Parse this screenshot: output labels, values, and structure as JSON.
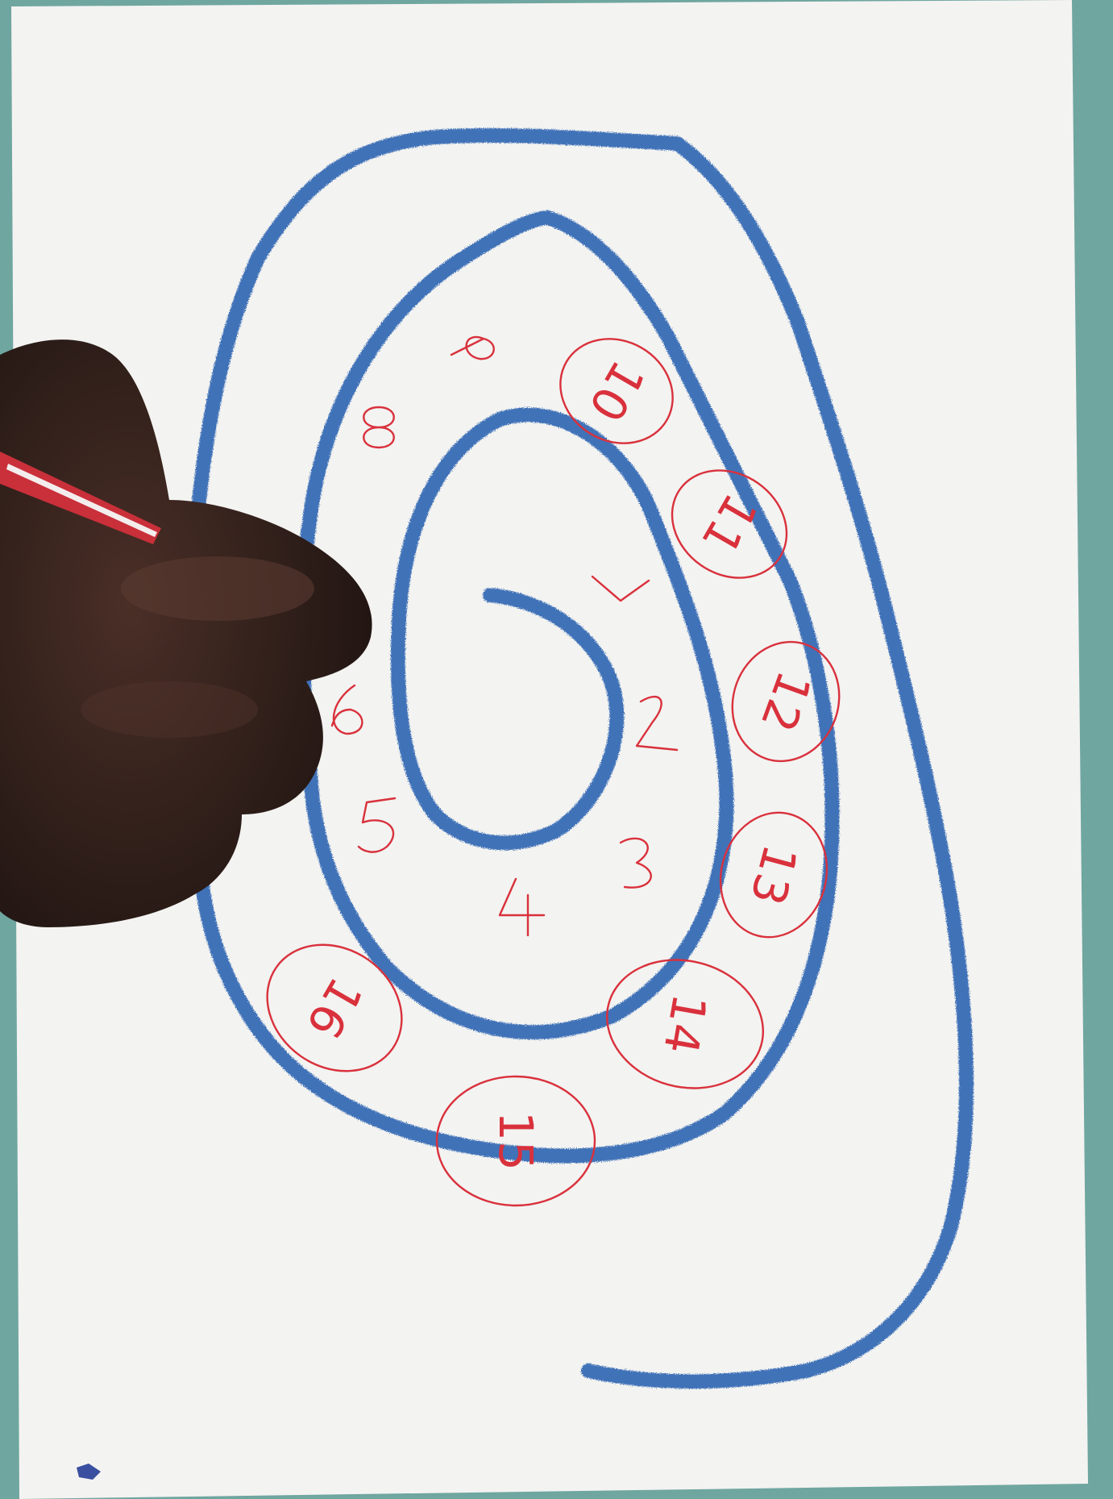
{
  "colors": {
    "background": "#6fa6a0",
    "paper": "#f4f4f2",
    "spiral": "#3f72b8",
    "ink": "#d9313c",
    "skin": "#3a2620",
    "marker_body": "#c9303a"
  },
  "numbers": {
    "plain": [
      "1",
      "2",
      "3",
      "4",
      "5",
      "6",
      "8",
      "9"
    ],
    "circled": [
      "10",
      "11",
      "12",
      "13",
      "14",
      "15",
      "16"
    ]
  }
}
